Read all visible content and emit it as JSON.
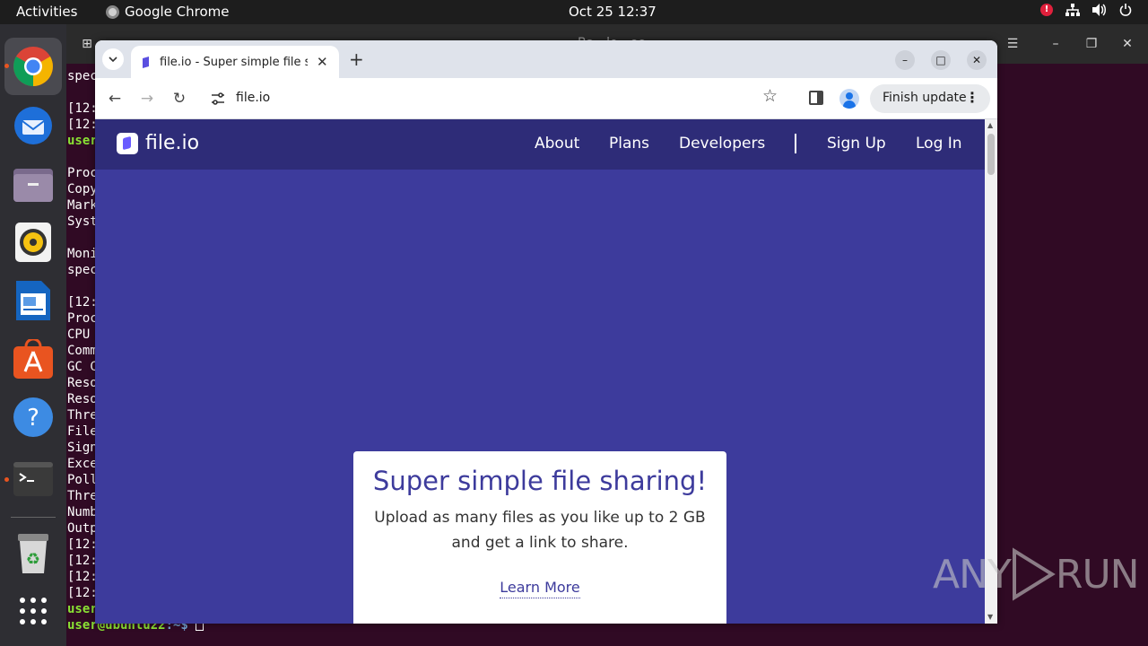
{
  "topbar": {
    "activities": "Activities",
    "app_name": "Google Chrome",
    "clock": "Oct 25  12:37"
  },
  "dock": {
    "items": [
      {
        "name": "Google Chrome",
        "icon": "chrome-icon"
      },
      {
        "name": "Thunderbird",
        "icon": "thunderbird-icon"
      },
      {
        "name": "Files",
        "icon": "files-icon"
      },
      {
        "name": "Rhythmbox",
        "icon": "rhythmbox-icon"
      },
      {
        "name": "LibreOffice Writer",
        "icon": "writer-icon"
      },
      {
        "name": "Ubuntu Software",
        "icon": "software-icon"
      },
      {
        "name": "Help",
        "icon": "help-icon"
      },
      {
        "name": "Terminal",
        "icon": "terminal-icon"
      },
      {
        "name": "Trash",
        "icon": "trash-icon"
      },
      {
        "name": "Show Applications",
        "icon": "app-grid-icon"
      }
    ]
  },
  "terminal": {
    "title": "Ba…lo…ee",
    "lines": [
      "spec",
      "",
      "[12:",
      "[12:",
      "user",
      "",
      "Proc",
      "Copy",
      "Mark",
      "Syst",
      "",
      "Moni",
      "spec",
      "",
      "[12:",
      "Proc",
      "CPU",
      "Comm",
      "GC C",
      "Reso",
      "Reso",
      "Thre",
      "File",
      "Sign",
      "Exce",
      "Poll",
      "Thre",
      "Numb",
      "Outp",
      "[12:",
      "[12:",
      "[12:",
      "[12:",
      "user"
    ],
    "prompt_user": "user@ubuntu22",
    "prompt_path": ":~$ "
  },
  "browser": {
    "tab_title": "file.io - Super simple file sharing",
    "url": "file.io",
    "finish_update": "Finish update"
  },
  "site": {
    "logo": "file.io",
    "nav": [
      "About",
      "Plans",
      "Developers",
      "Sign Up",
      "Log In"
    ],
    "hero_title": "Super simple file sharing!",
    "hero_text": "Upload as many files as you like up to 2 GB and get a link to share.",
    "learn_more": "Learn More"
  },
  "watermark": {
    "left": "ANY",
    "right": "RUN"
  },
  "colors": {
    "page_bg": "#3d3b9c",
    "nav_bg": "#2e2c78",
    "terminal_bg": "#300a24",
    "accent": "#3d3b9c"
  }
}
